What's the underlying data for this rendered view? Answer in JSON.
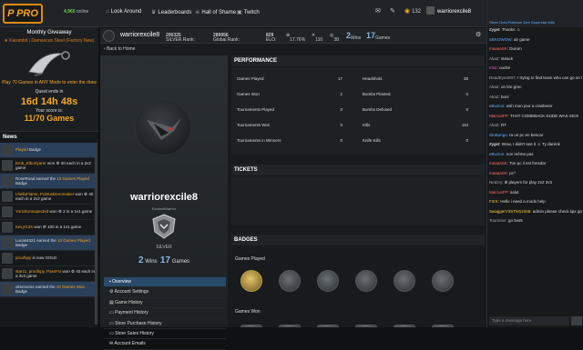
{
  "topbar": {
    "logo_text": "P PRO",
    "online_count": "4,965",
    "online_label": "online",
    "nav": [
      {
        "label": "Look Around",
        "icon": "home-icon"
      },
      {
        "label": "Leaderboards",
        "icon": "trophy-icon"
      },
      {
        "label": "Hall of Shame",
        "icon": "skull-icon"
      },
      {
        "label": "Twitch",
        "icon": "twitch-icon"
      }
    ],
    "points": "132",
    "username": "warriorexcile8"
  },
  "giveaway": {
    "title": "Monthly Giveaway",
    "item": "★ Karambit | Damascus Steel (Factory New)",
    "desc": "Play 70 Games in ANY Mode to enter the draw",
    "quest_label": "Quest ends in",
    "time": "16d 14h 48s",
    "score_label": "Your score is:",
    "score": "11/70 Games"
  },
  "news": {
    "title": "News",
    "items": [
      {
        "pre": "",
        "hl": "Played",
        "post": " Badge"
      },
      {
        "pre": "",
        "hl": "Emb_Elbortyarer",
        "post": " won ⚙ 40 each in a 2v2 game"
      },
      {
        "pre": "RoseRoad earned the ",
        "hl": "10 Games Played",
        "post": " Badge"
      },
      {
        "pre": "",
        "hl": "LhelloFlame, PoitrusDenomaker",
        "post": " won ⚙ 40 each in a 2v2 game"
      },
      {
        "pre": "",
        "hl": "YorickUnexpected",
        "post": " won ⚙ 2 in a 1v1 game"
      },
      {
        "pre": "",
        "hl": "KeLyG3X",
        "post": " won ⚙ 100 in a 1v1 game"
      },
      {
        "pre": "Lucas4321 earned the ",
        "hl": "10 Games Played",
        "post": " Badge"
      },
      {
        "pre": "",
        "hl": "proofspy",
        "post": " is now GOLD"
      },
      {
        "pre": "",
        "hl": "starz1, proofspy, PassFix",
        "post": " won ⚙ 40 each in a 3v3 game"
      },
      {
        "pre": "oknesome earned the ",
        "hl": "10 Games Won",
        "post": " Badge"
      }
    ]
  },
  "profile": {
    "name": "warriorexcile8",
    "silver_rank_label": "SILVER Rank:",
    "silver_rank": "206325",
    "global_rank_label": "Global Rank:",
    "global_rank": "289956",
    "elo_label": "ELO:",
    "elo": "829",
    "pct": "17.76%",
    "stat_a": "110",
    "stat_b": "38",
    "wins": "2",
    "wins_label": "Wins",
    "games": "17",
    "games_label": "Games",
    "back": "Back to Home",
    "subtitle": "ExcitedWarrior",
    "rank_name": "SILVER"
  },
  "menu": [
    {
      "label": "Overview",
      "active": true
    },
    {
      "label": "Account Settings"
    },
    {
      "label": "Game History"
    },
    {
      "label": "Payment History"
    },
    {
      "label": "Store Purchase History"
    },
    {
      "label": "Store Sales History"
    },
    {
      "label": "Account Emails"
    }
  ],
  "performance": {
    "title": "PERFORMANCE",
    "left": [
      {
        "label": "Games Played",
        "value": "17"
      },
      {
        "label": "Games Won",
        "value": "2"
      },
      {
        "label": "Tournaments Played",
        "value": "0"
      },
      {
        "label": "Tournaments Won",
        "value": "0"
      },
      {
        "label": "Tournaments in Winners",
        "value": "0"
      }
    ],
    "right": [
      {
        "label": "Headshots",
        "value": "38"
      },
      {
        "label": "Bombs Planted",
        "value": "0"
      },
      {
        "label": "Bombs Defused",
        "value": "0"
      },
      {
        "label": "Kills",
        "value": "110"
      },
      {
        "label": "Knife Kills",
        "value": "0"
      }
    ]
  },
  "tickets": {
    "title": "TICKETS"
  },
  "badges": {
    "title": "BADGES",
    "played_label": "Games Played",
    "won_label": "Games Won"
  },
  "chat": {
    "header": "Silver Gold Platinum 1km Superstar Kills",
    "placeholder": "Type a message here",
    "messages": [
      {
        "user": "Zyget:",
        "text": "Thanks ☺",
        "color": "#ffffff"
      },
      {
        "user": "SEKOWOW:",
        "text": "air game",
        "color": "#5fb4ff"
      },
      {
        "user": "maaaaSK:",
        "text": "Durum",
        "color": "#ff6b6b"
      },
      {
        "user": "AkaZ:",
        "text": "steack",
        "color": "#aaaaaa"
      },
      {
        "user": "Iris2:",
        "text": "caché",
        "color": "#ff5fd0"
      },
      {
        "user": "DeadEye2007:",
        "text": "I trying to find team who can go on tournament 5vs5 for free",
        "color": "#aaaaaa"
      },
      {
        "user": "AkaZ:",
        "text": "un tire grec",
        "color": "#aaaaaa"
      },
      {
        "user": "AkaZ:",
        "text": "boni",
        "color": "#aaaaaa"
      },
      {
        "user": "eBuzion:",
        "text": "wsh mon jour a crasherer",
        "color": "#5fb4ff"
      },
      {
        "user": "MarcusFP:",
        "text": "THAT COMEBACK DUDE WAS SICK",
        "color": "#ff6b6b"
      },
      {
        "user": "AkaZ:",
        "text": "RT",
        "color": "#aaaaaa"
      },
      {
        "user": "StoBongo:",
        "text": "ta un pc en bescar",
        "color": "#5fb4ff"
      },
      {
        "user": "Zyget:",
        "text": "Wow, I didn't see it ☺ Ty darenk",
        "color": "#ffffff"
      },
      {
        "user": "eBuzion:",
        "text": "non même pas",
        "color": "#5fb4ff"
      },
      {
        "user": "maaaaSK:",
        "text": "Ton pc il est fonsdar",
        "color": "#ff6b6b"
      },
      {
        "user": "maaaaSK:",
        "text": "pc^",
        "color": "#ff6b6b"
      },
      {
        "user": "Nedzry:",
        "text": "8l players for play 2v2 3v3",
        "color": "#aaaaaa"
      },
      {
        "user": "MarcusFP:",
        "text": "salut",
        "color": "#ff6b6b"
      },
      {
        "user": "F2rK:",
        "text": "Hello i need a mods help",
        "color": "#ffd24f"
      },
      {
        "user": "SwaggerV3STM12345:",
        "text": "admin please check lqix game # 1630098 prostgwp he was using wh",
        "color": "#ffd24f"
      },
      {
        "user": "Tourniser:",
        "text": "go 5vs5",
        "color": "#aaaaaa"
      }
    ]
  },
  "colors": {
    "accent": "#f5a623",
    "online": "#62d04b",
    "active_menu": "#2a4a6a"
  }
}
